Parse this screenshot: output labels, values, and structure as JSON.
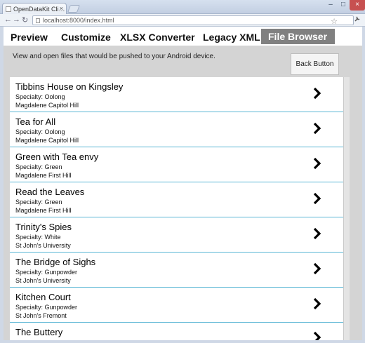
{
  "browser": {
    "tab_title": "OpenDataKit Cli…",
    "tab_close": "×",
    "url": "localhost:8000/index.html",
    "window_controls": {
      "minimize": "–",
      "maximize": "□",
      "close": "×"
    },
    "nav_glyphs": {
      "back": "←",
      "forward": "→",
      "reload": "↻",
      "star": "☆",
      "wrench": "🔧"
    }
  },
  "nav": {
    "items": [
      {
        "label": "Preview"
      },
      {
        "label": "Customize"
      },
      {
        "label": "XLSX Converter"
      },
      {
        "label": "Legacy XML"
      },
      {
        "label": "File Browser",
        "active": true
      }
    ]
  },
  "content": {
    "intro": "View and open files that would be pushed to your Android device.",
    "back_button": "Back Button"
  },
  "list": {
    "chevron": "❯",
    "items": [
      {
        "name": "Tibbins House on Kingsley",
        "specialty": "Specialty: Oolong",
        "location": "Magdalene Capitol Hill"
      },
      {
        "name": "Tea for All",
        "specialty": "Specialty: Oolong",
        "location": "Magdalene Capitol Hill"
      },
      {
        "name": "Green with Tea envy",
        "specialty": "Specialty: Green",
        "location": "Magdalene First Hill"
      },
      {
        "name": "Read the Leaves",
        "specialty": "Specialty: Green",
        "location": "Magdalene First Hill"
      },
      {
        "name": "Trinity's Spies",
        "specialty": "Specialty: White",
        "location": "St John's University"
      },
      {
        "name": "The Bridge of Sighs",
        "specialty": "Specialty: Gunpowder",
        "location": "St John's University"
      },
      {
        "name": "Kitchen Court",
        "specialty": "Specialty: Gunpowder",
        "location": "St John's Fremont"
      },
      {
        "name": "The Buttery",
        "specialty": "",
        "location": ""
      }
    ]
  },
  "colors": {
    "active_tab": "#808080",
    "divider": "#5ab6d4",
    "panel": "#d4d4d4"
  }
}
